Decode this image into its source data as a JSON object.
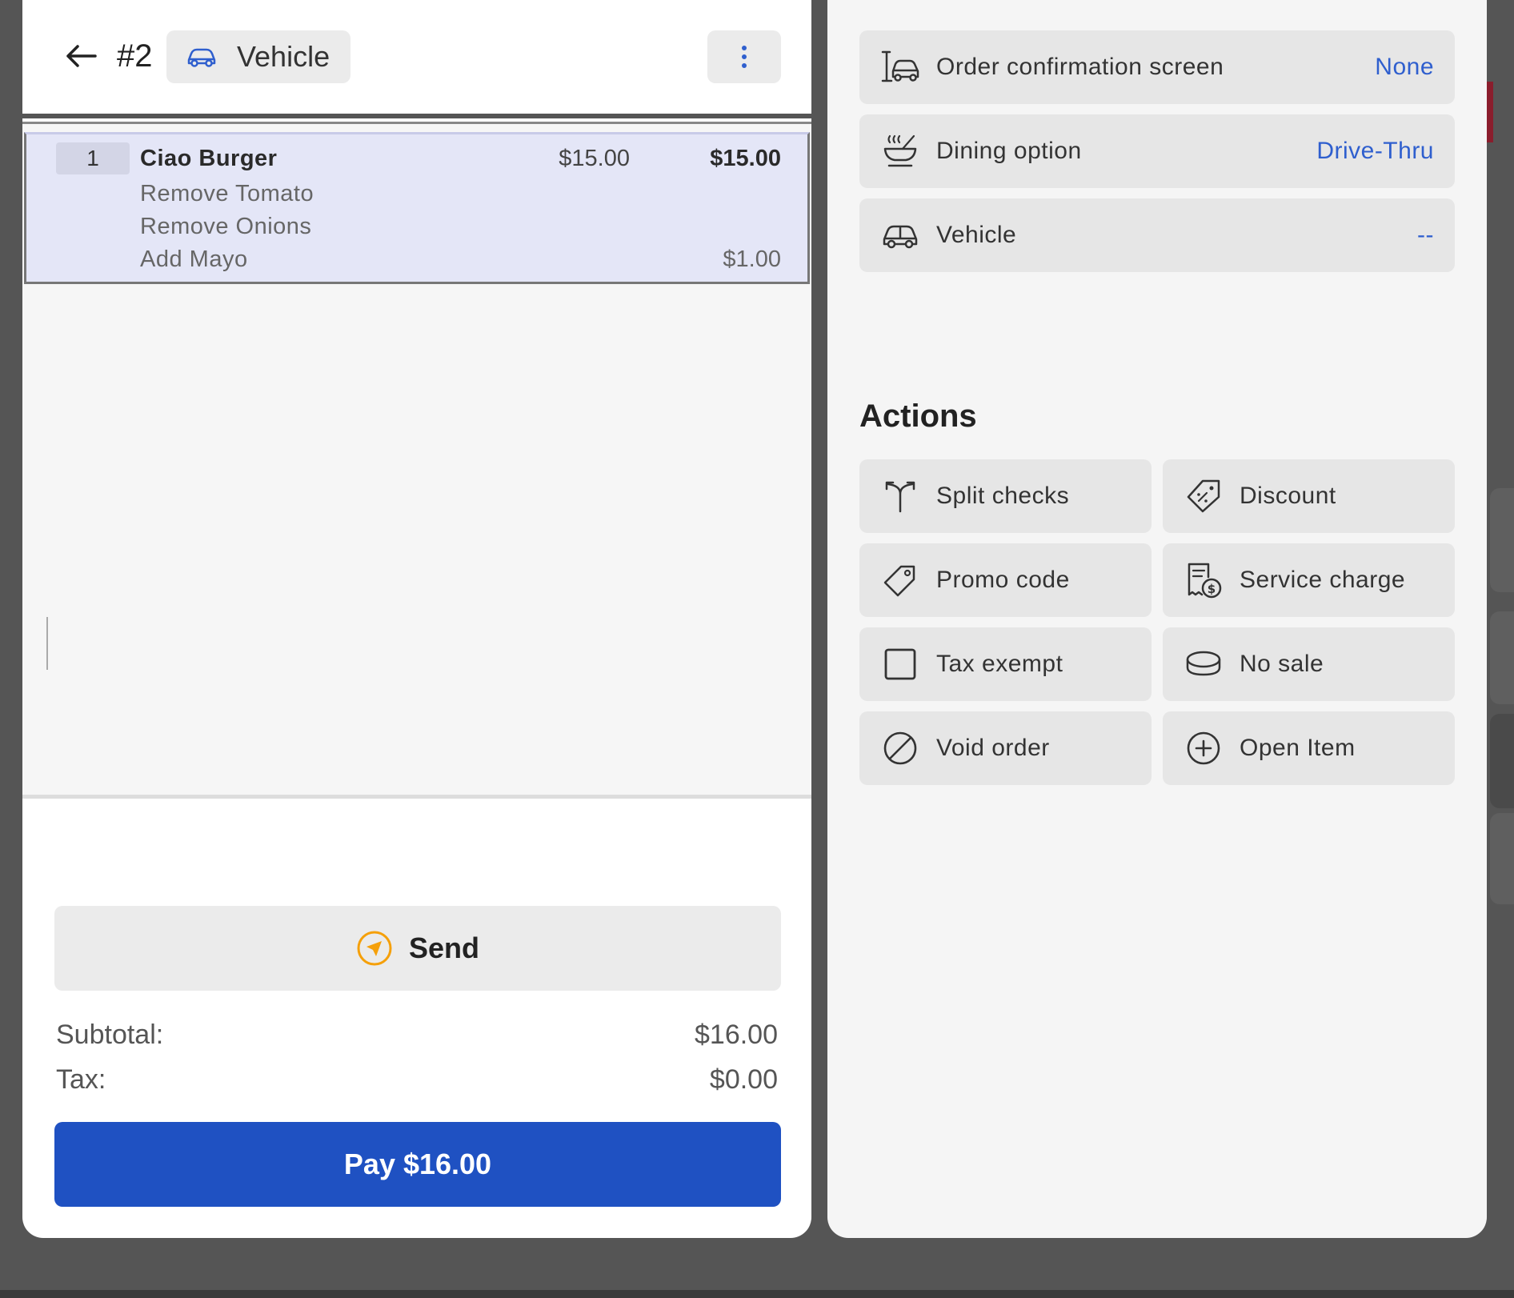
{
  "header": {
    "order_number": "#2",
    "chip_label": "Vehicle"
  },
  "order": {
    "item": {
      "qty": "1",
      "name": "Ciao Burger",
      "unit_price": "$15.00",
      "total": "$15.00",
      "modifiers": [
        {
          "label": "Remove Tomato",
          "price": ""
        },
        {
          "label": "Remove Onions",
          "price": ""
        },
        {
          "label": "Add Mayo",
          "price": "$1.00"
        }
      ]
    }
  },
  "footer": {
    "send_label": "Send",
    "subtotal_label": "Subtotal:",
    "subtotal_value": "$16.00",
    "tax_label": "Tax:",
    "tax_value": "$0.00",
    "pay_label": "Pay $16.00"
  },
  "options": [
    {
      "label": "Order confirmation screen",
      "value": "None",
      "icon": "car-screen-icon"
    },
    {
      "label": "Dining option",
      "value": "Drive-Thru",
      "icon": "dining-bowl-icon"
    },
    {
      "label": "Vehicle",
      "value": "--",
      "icon": "car-icon"
    }
  ],
  "actions_title": "Actions",
  "actions": [
    {
      "label": "Split checks",
      "icon": "split-arrows-icon"
    },
    {
      "label": "Discount",
      "icon": "discount-tag-icon"
    },
    {
      "label": "Promo code",
      "icon": "tag-icon"
    },
    {
      "label": "Service charge",
      "icon": "receipt-dollar-icon"
    },
    {
      "label": "Tax exempt",
      "icon": "checkbox-icon"
    },
    {
      "label": "No sale",
      "icon": "coin-icon"
    },
    {
      "label": "Void order",
      "icon": "void-circle-icon"
    },
    {
      "label": "Open Item",
      "icon": "plus-circle-icon"
    }
  ],
  "colors": {
    "accent_blue": "#1f51c2",
    "link_blue": "#2f5fce",
    "send_icon_orange": "#f5a00a",
    "selected_row": "#e4e6f7"
  }
}
